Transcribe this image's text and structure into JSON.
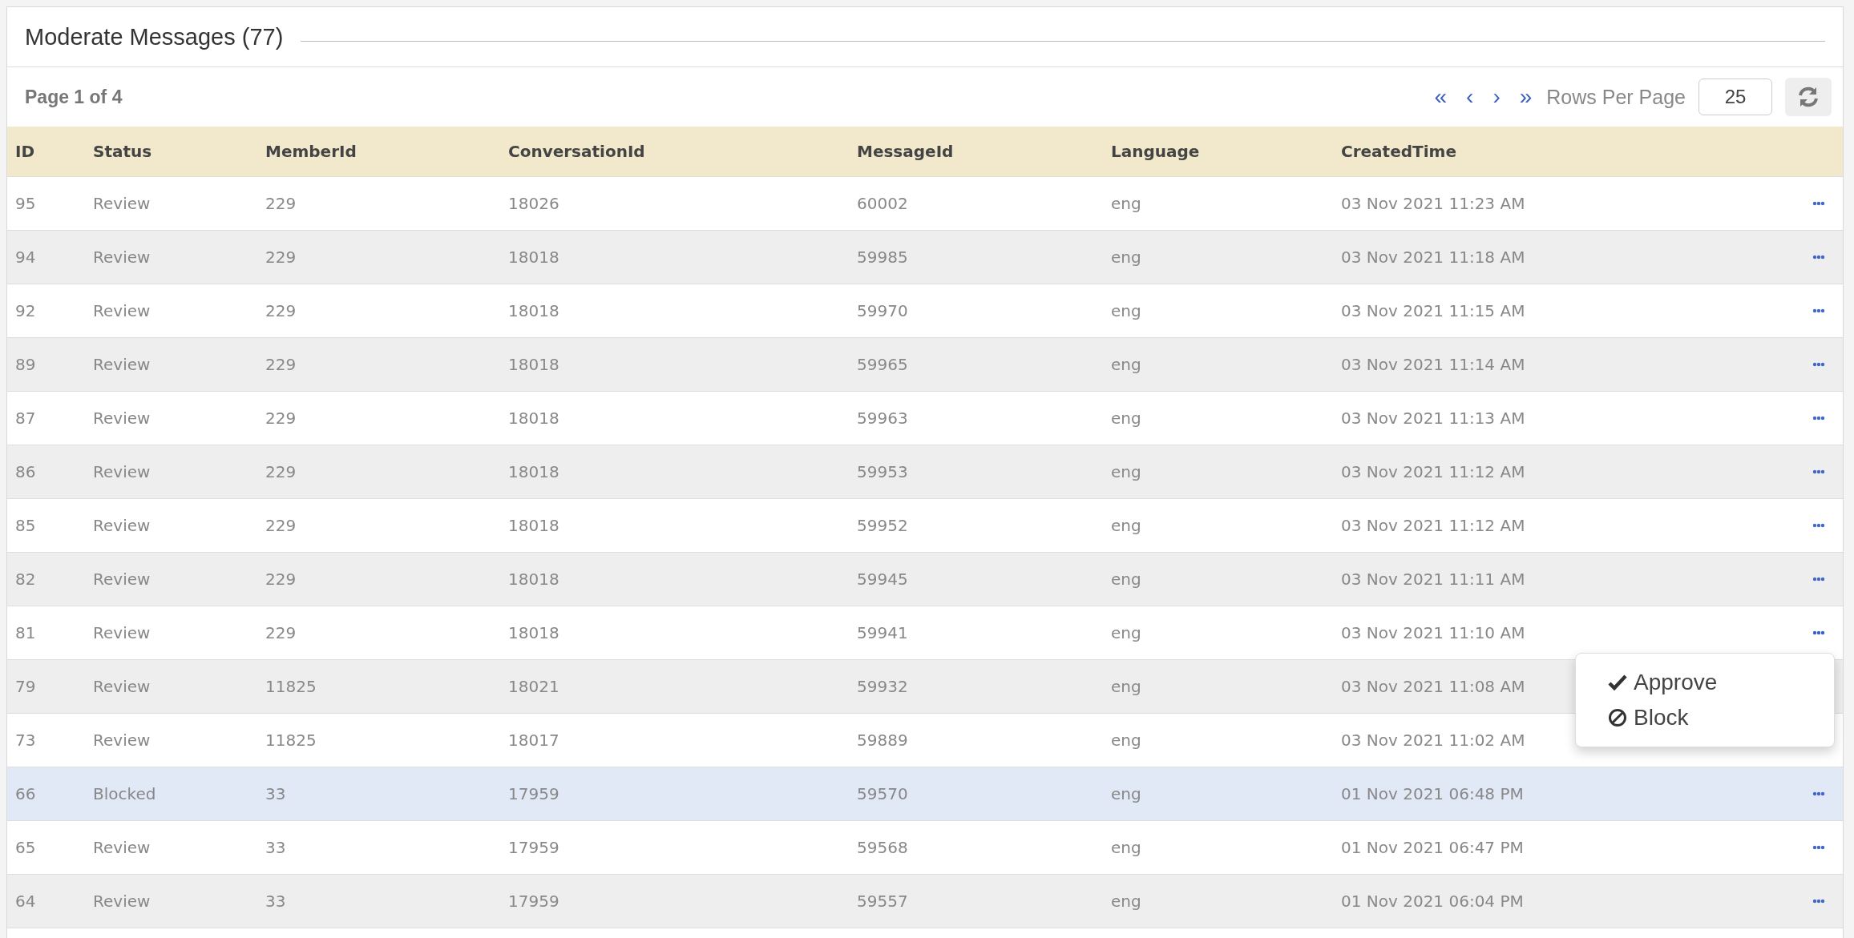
{
  "panel": {
    "title": "Moderate Messages (77)"
  },
  "toolbar": {
    "page_info": "Page 1 of 4",
    "pager": [
      "«",
      "‹",
      "›",
      "»"
    ],
    "rows_per_page_label": "Rows Per Page",
    "rows_per_page": "25"
  },
  "table": {
    "columns": [
      "ID",
      "Status",
      "MemberId",
      "ConversationId",
      "MessageId",
      "Language",
      "CreatedTime"
    ],
    "rows": [
      {
        "cells": [
          "95",
          "Review",
          "229",
          "18026",
          "60002",
          "eng",
          "03 Nov 2021 11:23 AM"
        ],
        "selected": false
      },
      {
        "cells": [
          "94",
          "Review",
          "229",
          "18018",
          "59985",
          "eng",
          "03 Nov 2021 11:18 AM"
        ],
        "selected": false
      },
      {
        "cells": [
          "92",
          "Review",
          "229",
          "18018",
          "59970",
          "eng",
          "03 Nov 2021 11:15 AM"
        ],
        "selected": false
      },
      {
        "cells": [
          "89",
          "Review",
          "229",
          "18018",
          "59965",
          "eng",
          "03 Nov 2021 11:14 AM"
        ],
        "selected": false
      },
      {
        "cells": [
          "87",
          "Review",
          "229",
          "18018",
          "59963",
          "eng",
          "03 Nov 2021 11:13 AM"
        ],
        "selected": false
      },
      {
        "cells": [
          "86",
          "Review",
          "229",
          "18018",
          "59953",
          "eng",
          "03 Nov 2021 11:12 AM"
        ],
        "selected": false
      },
      {
        "cells": [
          "85",
          "Review",
          "229",
          "18018",
          "59952",
          "eng",
          "03 Nov 2021 11:12 AM"
        ],
        "selected": false
      },
      {
        "cells": [
          "82",
          "Review",
          "229",
          "18018",
          "59945",
          "eng",
          "03 Nov 2021 11:11 AM"
        ],
        "selected": false
      },
      {
        "cells": [
          "81",
          "Review",
          "229",
          "18018",
          "59941",
          "eng",
          "03 Nov 2021 11:10 AM"
        ],
        "selected": false,
        "menu_open": true
      },
      {
        "cells": [
          "79",
          "Review",
          "11825",
          "18021",
          "59932",
          "eng",
          "03 Nov 2021 11:08 AM"
        ],
        "selected": false
      },
      {
        "cells": [
          "73",
          "Review",
          "11825",
          "18017",
          "59889",
          "eng",
          "03 Nov 2021 11:02 AM"
        ],
        "selected": false
      },
      {
        "cells": [
          "66",
          "Blocked",
          "33",
          "17959",
          "59570",
          "eng",
          "01 Nov 2021 06:48 PM"
        ],
        "selected": true
      },
      {
        "cells": [
          "65",
          "Review",
          "33",
          "17959",
          "59568",
          "eng",
          "01 Nov 2021 06:47 PM"
        ],
        "selected": false
      },
      {
        "cells": [
          "64",
          "Review",
          "33",
          "17959",
          "59557",
          "eng",
          "01 Nov 2021 06:04 PM"
        ],
        "selected": false
      }
    ]
  },
  "action_menu": {
    "items": [
      {
        "label": "Approve",
        "kind": "approve"
      },
      {
        "label": "Block",
        "kind": "block"
      }
    ]
  }
}
